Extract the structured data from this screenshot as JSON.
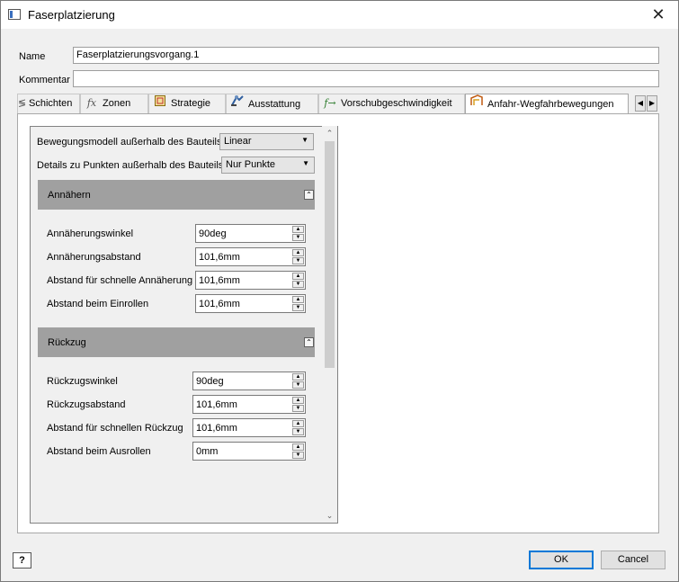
{
  "window": {
    "title": "Faserplatzierung",
    "close_symbol": "✕"
  },
  "form": {
    "name_label": "Name",
    "name_value": "Faserplatzierungsvorgang.1",
    "comment_label": "Kommentar",
    "comment_value": ""
  },
  "tabs": [
    {
      "label": "Schichten",
      "icon": "layers-icon"
    },
    {
      "label": "Zonen",
      "icon": "fx-icon"
    },
    {
      "label": "Strategie",
      "icon": "strategy-icon"
    },
    {
      "label": "Ausstattung",
      "icon": "machine-icon"
    },
    {
      "label": "Vorschubgeschwindigkeit",
      "icon": "feedrate-icon"
    },
    {
      "label": "Anfahr-Wegfahrbewegungen",
      "icon": "lead-in-out-icon"
    }
  ],
  "panel": {
    "motion_model_label": "Bewegungsmodell außerhalb des Bauteils",
    "motion_model_value": "Linear",
    "point_details_label": "Details zu Punkten außerhalb des Bauteils",
    "point_details_value": "Nur Punkte",
    "approach": {
      "title": "Annähern",
      "fields": [
        {
          "label": "Annäherungswinkel",
          "value": "90deg"
        },
        {
          "label": "Annäherungsabstand",
          "value": "101,6mm"
        },
        {
          "label": "Abstand für schnelle Annäherung",
          "value": "101,6mm"
        },
        {
          "label": "Abstand beim Einrollen",
          "value": "101,6mm"
        }
      ]
    },
    "retract": {
      "title": "Rückzug",
      "fields": [
        {
          "label": "Rückzugswinkel",
          "value": "90deg"
        },
        {
          "label": "Rückzugsabstand",
          "value": "101,6mm"
        },
        {
          "label": "Abstand für schnellen Rückzug",
          "value": "101,6mm"
        },
        {
          "label": "Abstand beim Ausrollen",
          "value": "0mm"
        }
      ]
    }
  },
  "footer": {
    "help_symbol": "?",
    "ok_label": "OK",
    "cancel_label": "Cancel"
  },
  "colors": {
    "accent": "#0078d7",
    "section_header": "#a0a0a0"
  }
}
